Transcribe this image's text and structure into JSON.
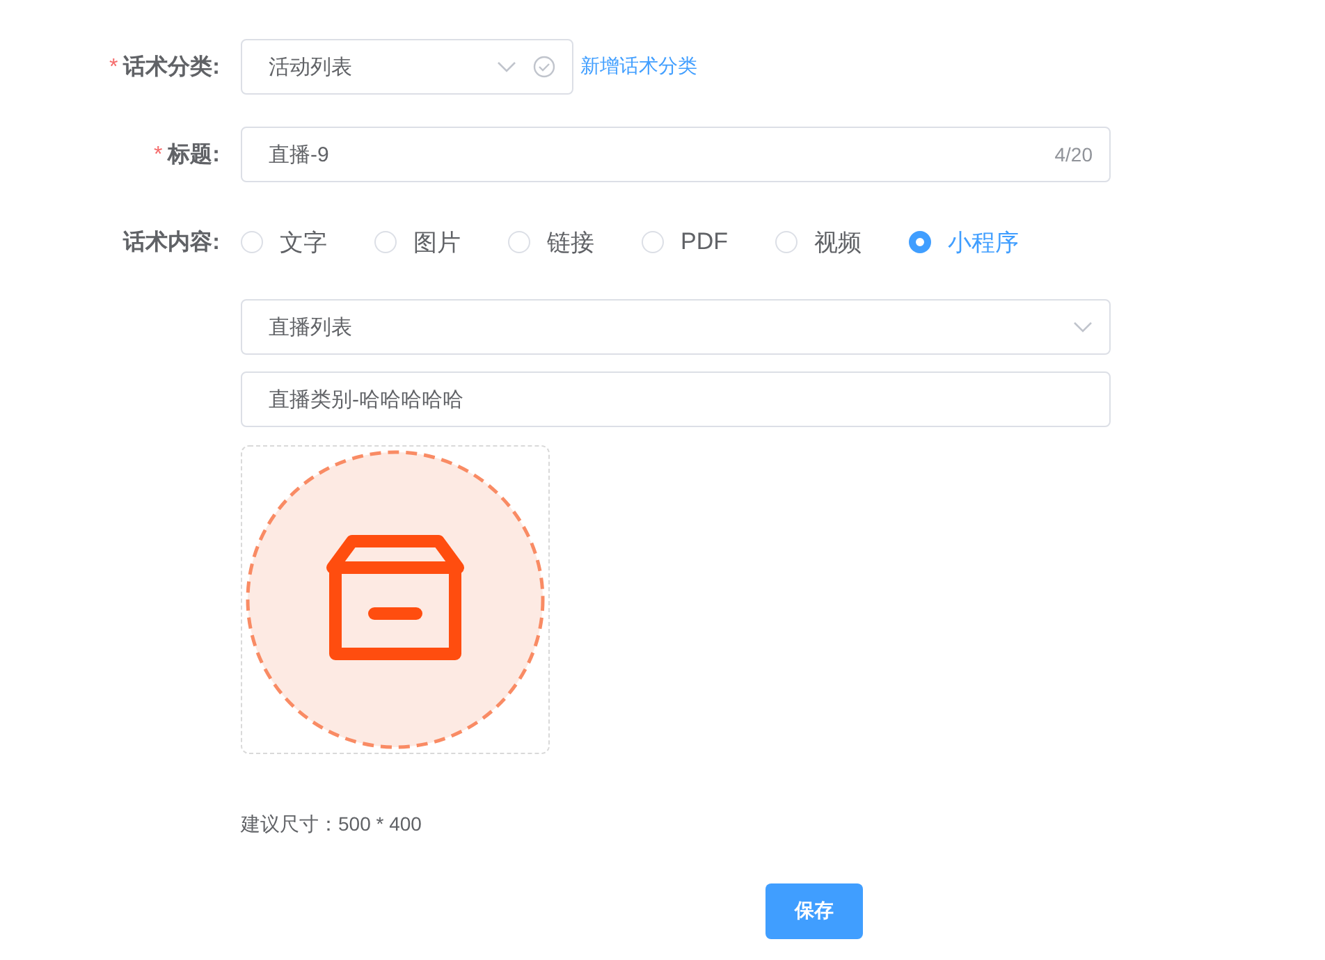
{
  "category": {
    "required_mark": "*",
    "label": "话术分类:",
    "value": "活动列表",
    "link": "新增话术分类"
  },
  "title": {
    "required_mark": "*",
    "label": "标题:",
    "value": "直播-9",
    "counter": "4/20"
  },
  "content": {
    "label": "话术内容:",
    "options": [
      {
        "label": "文字",
        "selected": false
      },
      {
        "label": "图片",
        "selected": false
      },
      {
        "label": "链接",
        "selected": false
      },
      {
        "label": "PDF",
        "selected": false
      },
      {
        "label": "视频",
        "selected": false
      },
      {
        "label": "小程序",
        "selected": true
      }
    ]
  },
  "mini_program": {
    "page_select": "直播列表",
    "page_param": "直播类别-哈哈哈哈哈",
    "size_hint": "建议尺寸：500 * 400"
  },
  "buttons": [
    "保存"
  ]
}
